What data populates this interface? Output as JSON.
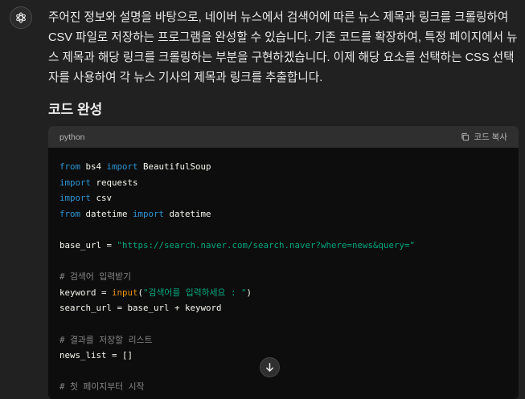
{
  "message": {
    "text": "주어진 정보와 설명을 바탕으로, 네이버 뉴스에서 검색어에 따른 뉴스 제목과 링크를 크롤링하여 CSV 파일로 저장하는 프로그램을 완성할 수 있습니다. 기존 코드를 확장하여, 특정 페이지에서 뉴스 제목과 해당 링크를 크롤링하는 부분을 구현하겠습니다. 이제 해당 요소를 선택하는 CSS 선택자를 사용하여 각 뉴스 기사의 제목과 링크를 추출합니다.",
    "heading": "코드 완성"
  },
  "code_block": {
    "language": "python",
    "copy_label": "코드 복사",
    "lines": [
      [
        {
          "t": "from",
          "c": "kw"
        },
        {
          "t": " bs4 "
        },
        {
          "t": "import",
          "c": "kw"
        },
        {
          "t": " BeautifulSoup"
        }
      ],
      [
        {
          "t": "import",
          "c": "kw"
        },
        {
          "t": " requests"
        }
      ],
      [
        {
          "t": "import",
          "c": "kw"
        },
        {
          "t": " csv"
        }
      ],
      [
        {
          "t": "from",
          "c": "kw"
        },
        {
          "t": " datetime "
        },
        {
          "t": "import",
          "c": "kw"
        },
        {
          "t": " datetime"
        }
      ],
      [],
      [
        {
          "t": "base_url = "
        },
        {
          "t": "\"https://search.naver.com/search.naver?where=news&query=\"",
          "c": "st"
        }
      ],
      [],
      [
        {
          "t": "# 검색어 입력받기",
          "c": "cm"
        }
      ],
      [
        {
          "t": "keyword = "
        },
        {
          "t": "input",
          "c": "fn"
        },
        {
          "t": "("
        },
        {
          "t": "\"검색어를 입력하세요 : \"",
          "c": "st"
        },
        {
          "t": ")"
        }
      ],
      [
        {
          "t": "search_url = base_url + keyword"
        }
      ],
      [],
      [
        {
          "t": "# 결과를 저장할 리스트",
          "c": "cm"
        }
      ],
      [
        {
          "t": "news_list = []"
        }
      ],
      [],
      [
        {
          "t": "# 첫 페이지부터 시작",
          "c": "cm"
        }
      ]
    ]
  },
  "colors": {
    "background": "#212121",
    "code_background": "#0d0d0d",
    "keyword": "#2e95d3",
    "string": "#00a67d",
    "comment": "#858585",
    "builtin": "#e9950c"
  },
  "icons": {
    "avatar": "openai-logo-icon",
    "copy": "copy-icon",
    "scroll": "arrow-down-icon"
  }
}
